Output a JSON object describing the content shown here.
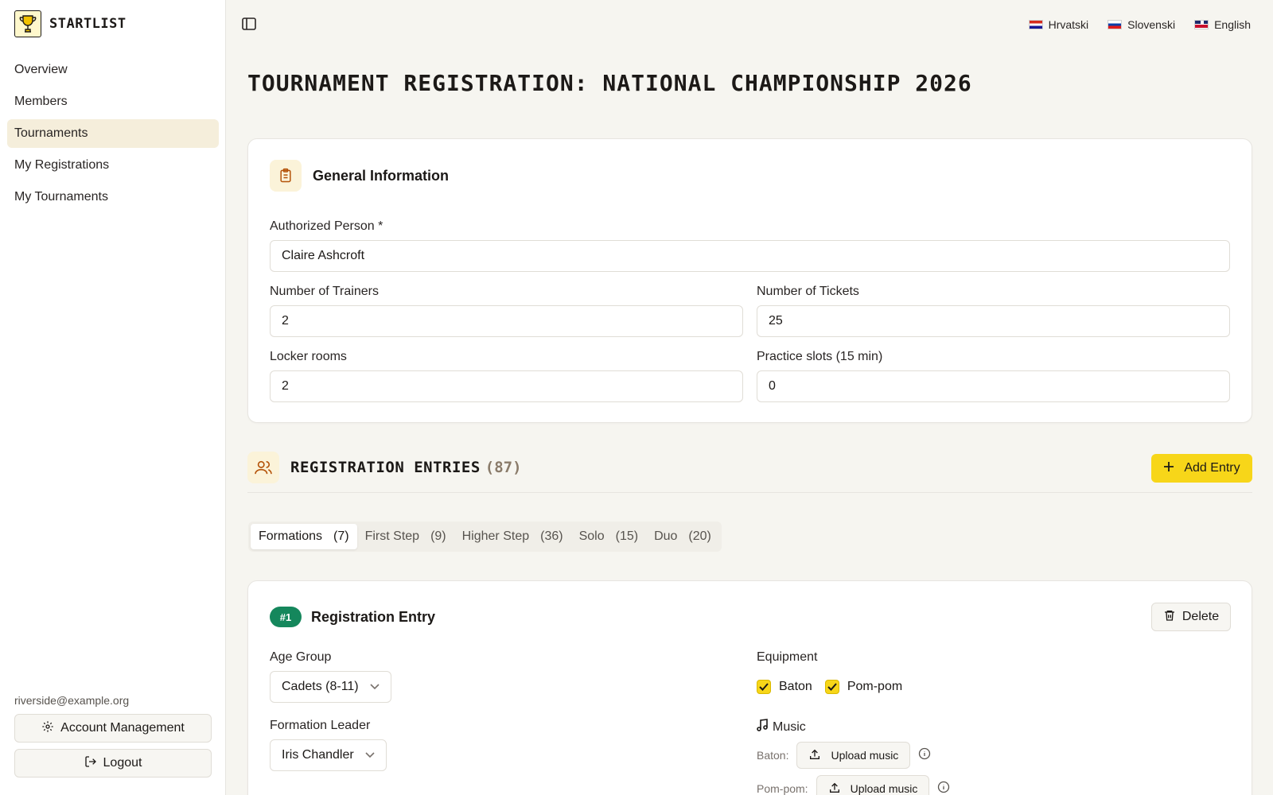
{
  "brand": {
    "name": "STARTLIST",
    "logo_icon": "trophy-icon"
  },
  "sidebar": {
    "items": [
      {
        "label": "Overview",
        "active": false
      },
      {
        "label": "Members",
        "active": false
      },
      {
        "label": "Tournaments",
        "active": true
      },
      {
        "label": "My Registrations",
        "active": false
      },
      {
        "label": "My Tournaments",
        "active": false
      }
    ],
    "user_email": "riverside@example.org",
    "account_label": "Account Management",
    "logout_label": "Logout"
  },
  "languages": [
    {
      "label": "Hrvatski",
      "flag": "flag-hr"
    },
    {
      "label": "Slovenski",
      "flag": "flag-si"
    },
    {
      "label": "English",
      "flag": "flag-gb"
    }
  ],
  "page": {
    "title": "TOURNAMENT REGISTRATION: NATIONAL CHAMPIONSHIP 2026"
  },
  "general": {
    "title": "General Information",
    "authorized_label": "Authorized Person *",
    "authorized_value": "Claire Ashcroft",
    "trainers_label": "Number of Trainers",
    "trainers_value": "2",
    "tickets_label": "Number of Tickets",
    "tickets_value": "25",
    "lockers_label": "Locker rooms",
    "lockers_value": "2",
    "practice_label": "Practice slots (15 min)",
    "practice_value": "0"
  },
  "entries": {
    "title": "REGISTRATION ENTRIES",
    "count": "(87)",
    "add_label": "Add Entry",
    "tabs": [
      {
        "label": "Formations",
        "count": "(7)",
        "active": true
      },
      {
        "label": "First Step",
        "count": "(9)",
        "active": false
      },
      {
        "label": "Higher Step",
        "count": "(36)",
        "active": false
      },
      {
        "label": "Solo",
        "count": "(15)",
        "active": false
      },
      {
        "label": "Duo",
        "count": "(20)",
        "active": false
      }
    ]
  },
  "entry": {
    "badge": "#1",
    "title": "Registration Entry",
    "delete_label": "Delete",
    "age_label": "Age Group",
    "age_value": "Cadets (8-11)",
    "leader_label": "Formation Leader",
    "leader_value": "Iris Chandler",
    "equipment_label": "Equipment",
    "equipment": [
      {
        "label": "Baton",
        "checked": true
      },
      {
        "label": "Pom-pom",
        "checked": true
      }
    ],
    "music_label": "Music",
    "music_rows": [
      {
        "label": "Baton:",
        "button": "Upload music"
      },
      {
        "label": "Pom-pom:",
        "button": "Upload music"
      }
    ]
  },
  "colors": {
    "accent": "#f7d619",
    "badge": "#15875c",
    "active_nav": "#f5eedb"
  }
}
